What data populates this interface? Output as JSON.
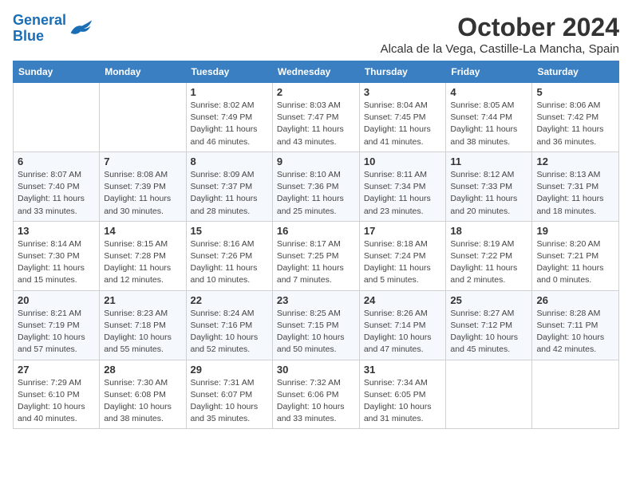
{
  "logo": {
    "line1": "General",
    "line2": "Blue"
  },
  "title": "October 2024",
  "location": "Alcala de la Vega, Castille-La Mancha, Spain",
  "days_of_week": [
    "Sunday",
    "Monday",
    "Tuesday",
    "Wednesday",
    "Thursday",
    "Friday",
    "Saturday"
  ],
  "weeks": [
    [
      {
        "day": "",
        "sunrise": "",
        "sunset": "",
        "daylight": ""
      },
      {
        "day": "",
        "sunrise": "",
        "sunset": "",
        "daylight": ""
      },
      {
        "day": "1",
        "sunrise": "Sunrise: 8:02 AM",
        "sunset": "Sunset: 7:49 PM",
        "daylight": "Daylight: 11 hours and 46 minutes."
      },
      {
        "day": "2",
        "sunrise": "Sunrise: 8:03 AM",
        "sunset": "Sunset: 7:47 PM",
        "daylight": "Daylight: 11 hours and 43 minutes."
      },
      {
        "day": "3",
        "sunrise": "Sunrise: 8:04 AM",
        "sunset": "Sunset: 7:45 PM",
        "daylight": "Daylight: 11 hours and 41 minutes."
      },
      {
        "day": "4",
        "sunrise": "Sunrise: 8:05 AM",
        "sunset": "Sunset: 7:44 PM",
        "daylight": "Daylight: 11 hours and 38 minutes."
      },
      {
        "day": "5",
        "sunrise": "Sunrise: 8:06 AM",
        "sunset": "Sunset: 7:42 PM",
        "daylight": "Daylight: 11 hours and 36 minutes."
      }
    ],
    [
      {
        "day": "6",
        "sunrise": "Sunrise: 8:07 AM",
        "sunset": "Sunset: 7:40 PM",
        "daylight": "Daylight: 11 hours and 33 minutes."
      },
      {
        "day": "7",
        "sunrise": "Sunrise: 8:08 AM",
        "sunset": "Sunset: 7:39 PM",
        "daylight": "Daylight: 11 hours and 30 minutes."
      },
      {
        "day": "8",
        "sunrise": "Sunrise: 8:09 AM",
        "sunset": "Sunset: 7:37 PM",
        "daylight": "Daylight: 11 hours and 28 minutes."
      },
      {
        "day": "9",
        "sunrise": "Sunrise: 8:10 AM",
        "sunset": "Sunset: 7:36 PM",
        "daylight": "Daylight: 11 hours and 25 minutes."
      },
      {
        "day": "10",
        "sunrise": "Sunrise: 8:11 AM",
        "sunset": "Sunset: 7:34 PM",
        "daylight": "Daylight: 11 hours and 23 minutes."
      },
      {
        "day": "11",
        "sunrise": "Sunrise: 8:12 AM",
        "sunset": "Sunset: 7:33 PM",
        "daylight": "Daylight: 11 hours and 20 minutes."
      },
      {
        "day": "12",
        "sunrise": "Sunrise: 8:13 AM",
        "sunset": "Sunset: 7:31 PM",
        "daylight": "Daylight: 11 hours and 18 minutes."
      }
    ],
    [
      {
        "day": "13",
        "sunrise": "Sunrise: 8:14 AM",
        "sunset": "Sunset: 7:30 PM",
        "daylight": "Daylight: 11 hours and 15 minutes."
      },
      {
        "day": "14",
        "sunrise": "Sunrise: 8:15 AM",
        "sunset": "Sunset: 7:28 PM",
        "daylight": "Daylight: 11 hours and 12 minutes."
      },
      {
        "day": "15",
        "sunrise": "Sunrise: 8:16 AM",
        "sunset": "Sunset: 7:26 PM",
        "daylight": "Daylight: 11 hours and 10 minutes."
      },
      {
        "day": "16",
        "sunrise": "Sunrise: 8:17 AM",
        "sunset": "Sunset: 7:25 PM",
        "daylight": "Daylight: 11 hours and 7 minutes."
      },
      {
        "day": "17",
        "sunrise": "Sunrise: 8:18 AM",
        "sunset": "Sunset: 7:24 PM",
        "daylight": "Daylight: 11 hours and 5 minutes."
      },
      {
        "day": "18",
        "sunrise": "Sunrise: 8:19 AM",
        "sunset": "Sunset: 7:22 PM",
        "daylight": "Daylight: 11 hours and 2 minutes."
      },
      {
        "day": "19",
        "sunrise": "Sunrise: 8:20 AM",
        "sunset": "Sunset: 7:21 PM",
        "daylight": "Daylight: 11 hours and 0 minutes."
      }
    ],
    [
      {
        "day": "20",
        "sunrise": "Sunrise: 8:21 AM",
        "sunset": "Sunset: 7:19 PM",
        "daylight": "Daylight: 10 hours and 57 minutes."
      },
      {
        "day": "21",
        "sunrise": "Sunrise: 8:23 AM",
        "sunset": "Sunset: 7:18 PM",
        "daylight": "Daylight: 10 hours and 55 minutes."
      },
      {
        "day": "22",
        "sunrise": "Sunrise: 8:24 AM",
        "sunset": "Sunset: 7:16 PM",
        "daylight": "Daylight: 10 hours and 52 minutes."
      },
      {
        "day": "23",
        "sunrise": "Sunrise: 8:25 AM",
        "sunset": "Sunset: 7:15 PM",
        "daylight": "Daylight: 10 hours and 50 minutes."
      },
      {
        "day": "24",
        "sunrise": "Sunrise: 8:26 AM",
        "sunset": "Sunset: 7:14 PM",
        "daylight": "Daylight: 10 hours and 47 minutes."
      },
      {
        "day": "25",
        "sunrise": "Sunrise: 8:27 AM",
        "sunset": "Sunset: 7:12 PM",
        "daylight": "Daylight: 10 hours and 45 minutes."
      },
      {
        "day": "26",
        "sunrise": "Sunrise: 8:28 AM",
        "sunset": "Sunset: 7:11 PM",
        "daylight": "Daylight: 10 hours and 42 minutes."
      }
    ],
    [
      {
        "day": "27",
        "sunrise": "Sunrise: 7:29 AM",
        "sunset": "Sunset: 6:10 PM",
        "daylight": "Daylight: 10 hours and 40 minutes."
      },
      {
        "day": "28",
        "sunrise": "Sunrise: 7:30 AM",
        "sunset": "Sunset: 6:08 PM",
        "daylight": "Daylight: 10 hours and 38 minutes."
      },
      {
        "day": "29",
        "sunrise": "Sunrise: 7:31 AM",
        "sunset": "Sunset: 6:07 PM",
        "daylight": "Daylight: 10 hours and 35 minutes."
      },
      {
        "day": "30",
        "sunrise": "Sunrise: 7:32 AM",
        "sunset": "Sunset: 6:06 PM",
        "daylight": "Daylight: 10 hours and 33 minutes."
      },
      {
        "day": "31",
        "sunrise": "Sunrise: 7:34 AM",
        "sunset": "Sunset: 6:05 PM",
        "daylight": "Daylight: 10 hours and 31 minutes."
      },
      {
        "day": "",
        "sunrise": "",
        "sunset": "",
        "daylight": ""
      },
      {
        "day": "",
        "sunrise": "",
        "sunset": "",
        "daylight": ""
      }
    ]
  ]
}
